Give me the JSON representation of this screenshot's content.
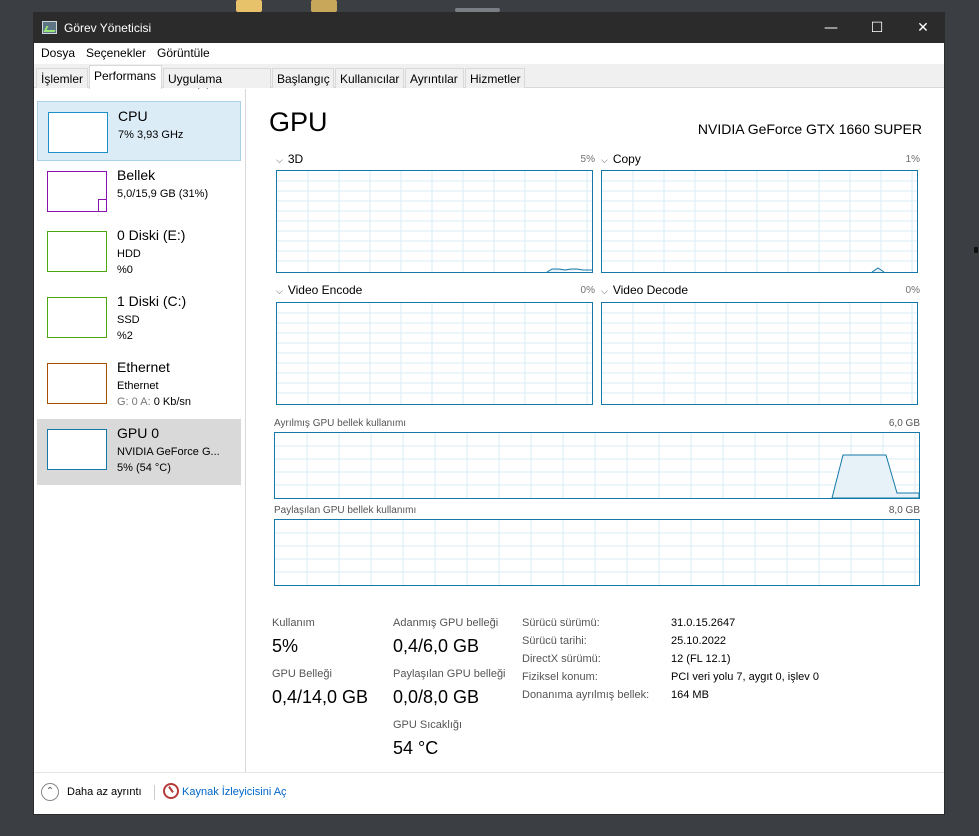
{
  "window": {
    "title": "Görev Yöneticisi"
  },
  "titlebar_buttons": {
    "minimize": "—",
    "maximize": "☐",
    "close": "✕"
  },
  "menu": [
    "Dosya",
    "Seçenekler",
    "Görüntüle"
  ],
  "tabs": [
    "İşlemler",
    "Performans",
    "Uygulama geçmişi",
    "Başlangıç",
    "Kullanıcılar",
    "Ayrıntılar",
    "Hizmetler"
  ],
  "active_tab": "Performans",
  "sidebar": [
    {
      "title": "CPU",
      "line2": "7% 3,93 GHz",
      "line3": "",
      "color": "#1a8fc9"
    },
    {
      "title": "Bellek",
      "line2": "5,0/15,9 GB (31%)",
      "line3": "",
      "color": "#8b12ae"
    },
    {
      "title": "0 Diski (E:)",
      "line2": "HDD",
      "line3": "%0",
      "color": "#4da60c"
    },
    {
      "title": "1 Diski (C:)",
      "line2": "SSD",
      "line3": "%2",
      "color": "#4da60c"
    },
    {
      "title": "Ethernet",
      "line2": "Ethernet",
      "line3_prefix": "G: 0 A:",
      "line3_value": "0 Kb/sn",
      "color": "#a74f01"
    },
    {
      "title": "GPU 0",
      "line2": "NVIDIA GeForce G...",
      "line3": "5% (54 °C)",
      "color": "#1479a8"
    }
  ],
  "gpu": {
    "title": "GPU",
    "model": "NVIDIA GeForce GTX 1660 SUPER",
    "engines": [
      {
        "name": "3D",
        "percent": "5%"
      },
      {
        "name": "Copy",
        "percent": "1%"
      },
      {
        "name": "Video Encode",
        "percent": "0%"
      },
      {
        "name": "Video Decode",
        "percent": "0%"
      }
    ],
    "dedicated_caption": "Ayrılmış GPU bellek kullanımı",
    "dedicated_max": "6,0 GB",
    "shared_caption": "Paylaşılan GPU bellek kullanımı",
    "shared_max": "8,0 GB",
    "stats": {
      "usage_label": "Kullanım",
      "usage_value": "5%",
      "gpu_mem_label": "GPU Belleği",
      "gpu_mem_value": "0,4/14,0 GB",
      "dedicated_label": "Adanmış GPU belleği",
      "dedicated_value": "0,4/6,0 GB",
      "shared_label": "Paylaşılan GPU belleği",
      "shared_value": "0,0/8,0 GB",
      "temp_label": "GPU Sıcaklığı",
      "temp_value": "54 °C"
    },
    "info": [
      {
        "key": "Sürücü sürümü:",
        "value": "31.0.15.2647"
      },
      {
        "key": "Sürücü tarihi:",
        "value": "25.10.2022"
      },
      {
        "key": "DirectX sürümü:",
        "value": "12 (FL 12.1)"
      },
      {
        "key": "Fiziksel konum:",
        "value": "PCI veri yolu 7, aygıt 0, işlev 0"
      },
      {
        "key": "Donanıma ayrılmış bellek:",
        "value": "164 MB"
      }
    ]
  },
  "footer": {
    "fewer_details": "Daha az ayrıntı",
    "resource_monitor": "Kaynak İzleyicisini Aç"
  },
  "colors": {
    "graph_border": "#1479a8",
    "grid": "#d9ebf4",
    "titlebar": "#2b2b2b"
  }
}
